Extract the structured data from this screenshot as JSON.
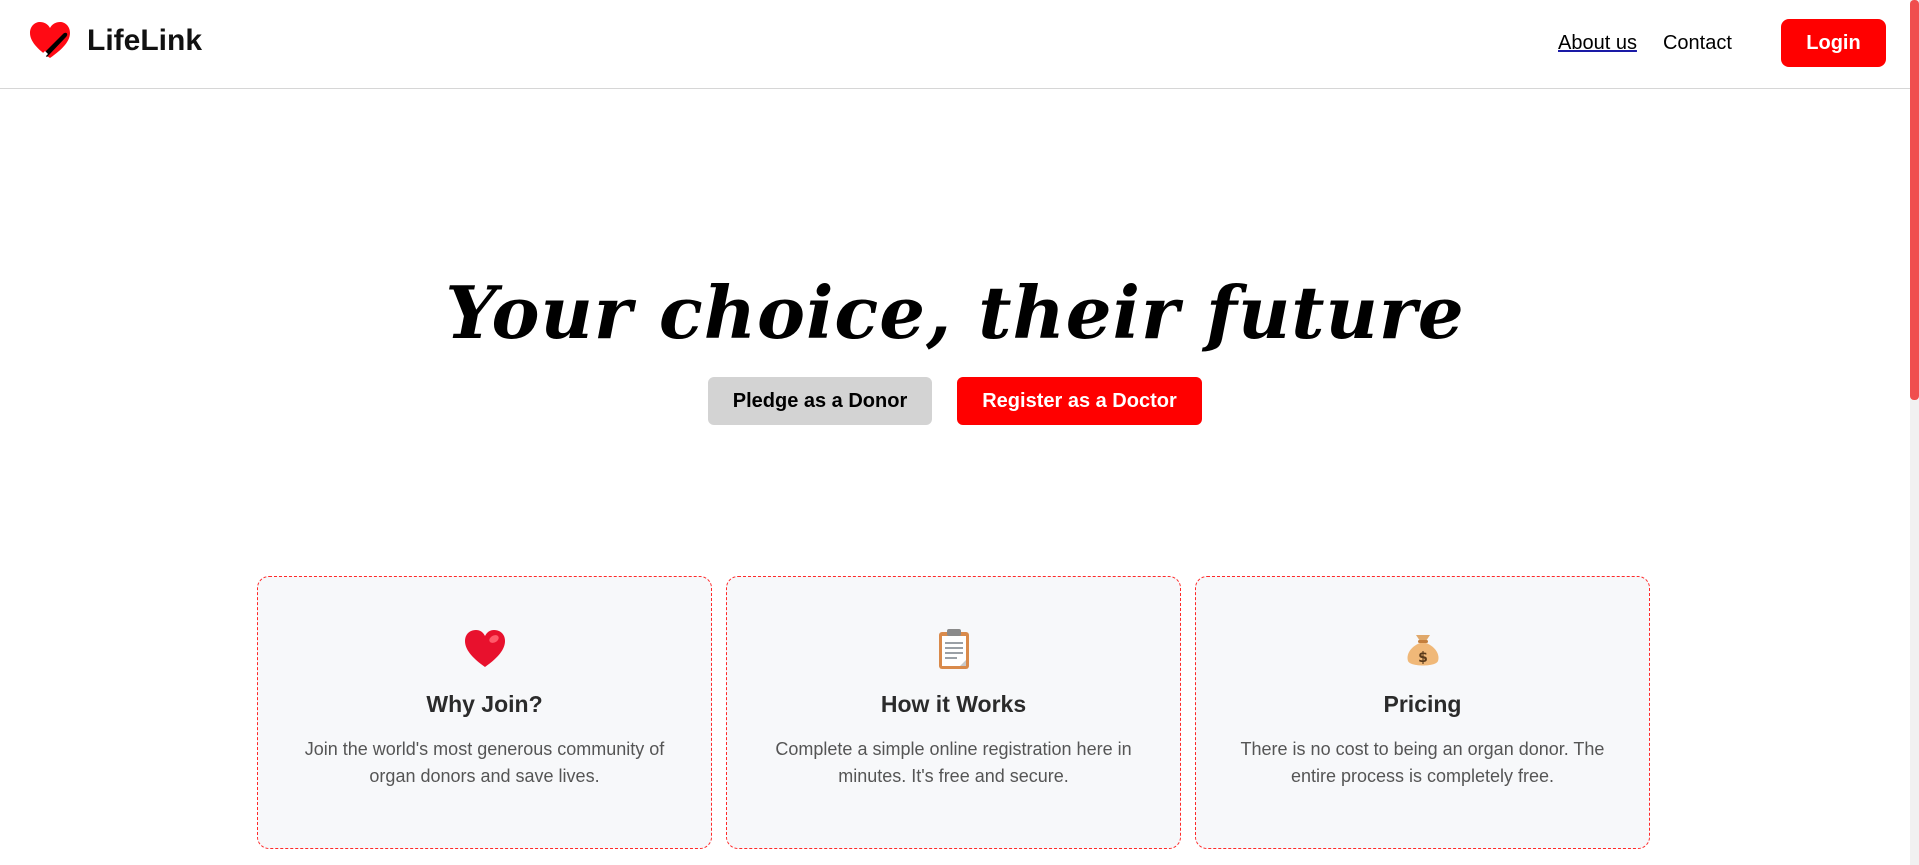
{
  "header": {
    "brand": {
      "name": "LifeLink",
      "icon": "heart-logo-icon"
    },
    "nav": {
      "about_label": "About us",
      "contact_label": "Contact"
    },
    "login_label": "Login"
  },
  "hero": {
    "title": "Your choice, their future",
    "donor_button": "Pledge as a Donor",
    "doctor_button": "Register as a Doctor"
  },
  "cards": [
    {
      "icon": "heart-icon",
      "title": "Why Join?",
      "text": "Join the world's most generous community of organ donors and save lives."
    },
    {
      "icon": "clipboard-icon",
      "title": "How it Works",
      "text": "Complete a simple online registration here in minutes. It's free and secure."
    },
    {
      "icon": "money-bag-icon",
      "title": "Pricing",
      "text": "There is no cost to being an organ donor. The entire process is completely free."
    }
  ],
  "colors": {
    "accent": "#ff0000",
    "secondary_button": "#d3d3d3",
    "card_border": "#ff2a2a",
    "card_bg": "#f7f8fa"
  }
}
